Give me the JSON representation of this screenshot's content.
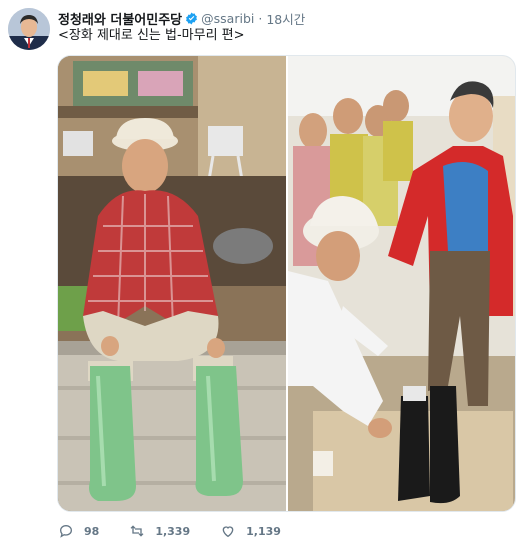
{
  "tweet": {
    "display_name": "정청래와 더불어민주당",
    "handle": "@ssaribi",
    "separator": "·",
    "timestamp": "18시간",
    "text": "<장화 제대로 신는 법-마무리 편>"
  },
  "media": {
    "left_photo_icon": "photo-man-in-boots",
    "right_photo_icon": "photo-man-being-helped-with-boots"
  },
  "actions": {
    "reply_count": "98",
    "retweet_count": "1,339",
    "like_count": "1,139"
  },
  "colors": {
    "verified": "#1da1f2",
    "muted_text": "#657786",
    "boots_green": "#7fc48a",
    "jacket_red": "#d42a2a"
  }
}
